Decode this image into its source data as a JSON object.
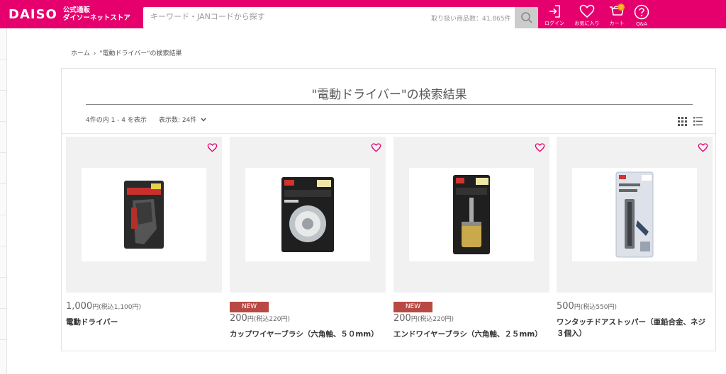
{
  "header": {
    "logo": "DAISO",
    "logo_sub_1": "公式通販",
    "logo_sub_2": "ダイソーネットストア",
    "search_placeholder": "キーワード・JANコードから探す",
    "search_count": "取り扱い商品数：41,865件",
    "nav": [
      {
        "label": "ログイン",
        "icon": "login-icon"
      },
      {
        "label": "お気に入り",
        "icon": "heart-icon"
      },
      {
        "label": "カート",
        "icon": "cart-icon",
        "badge": "0"
      },
      {
        "label": "Q&A",
        "icon": "question-icon"
      }
    ]
  },
  "breadcrumb": {
    "home": "ホーム",
    "separator": "›",
    "current": "\"電動ドライバー\"の検索結果"
  },
  "results": {
    "title": "\"電動ドライバー\"の検索結果",
    "count_text": "4件の内 1 - 4 を表示",
    "per_page_text": "表示数: 24件"
  },
  "products": [
    {
      "new": "",
      "price": "1,000",
      "yen": "円",
      "tax": "(税込1,100円)",
      "name": "電動ドライバー",
      "image": "electric-screwdriver-package"
    },
    {
      "new": "NEW",
      "price": "200",
      "yen": "円",
      "tax": "(税込220円)",
      "name": "カップワイヤーブラシ（六角軸、５０mm）",
      "image": "cup-wire-brush-package"
    },
    {
      "new": "NEW",
      "price": "200",
      "yen": "円",
      "tax": "(税込220円)",
      "name": "エンドワイヤーブラシ（六角軸、２５mm）",
      "image": "end-wire-brush-package"
    },
    {
      "new": "",
      "price": "500",
      "yen": "円",
      "tax": "(税込550円)",
      "name": "ワンタッチドアストッパー（亜鉛合金、ネジ３個入）",
      "image": "door-stopper-package"
    }
  ],
  "colors": {
    "brand_pink": "#e6006e",
    "new_badge": "#b84a43",
    "favorite_heart": "#e6006e",
    "card_bg": "#f1f1f1"
  }
}
